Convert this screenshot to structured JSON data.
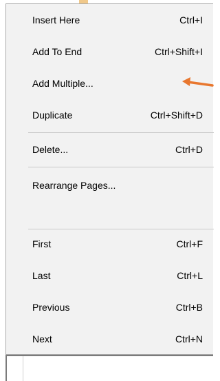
{
  "menu": {
    "items": [
      {
        "label": "Insert Here",
        "shortcut": "Ctrl+I"
      },
      {
        "label": "Add To End",
        "shortcut": "Ctrl+Shift+I"
      },
      {
        "label": "Add Multiple...",
        "shortcut": ""
      },
      {
        "label": "Duplicate",
        "shortcut": "Ctrl+Shift+D"
      },
      {
        "label": "Delete...",
        "shortcut": "Ctrl+D"
      },
      {
        "label": "Rearrange Pages...",
        "shortcut": ""
      },
      {
        "label": "First",
        "shortcut": "Ctrl+F"
      },
      {
        "label": "Last",
        "shortcut": "Ctrl+L"
      },
      {
        "label": "Previous",
        "shortcut": "Ctrl+B"
      },
      {
        "label": "Next",
        "shortcut": "Ctrl+N"
      }
    ]
  },
  "annotation": {
    "arrow_color": "#e8772e",
    "points_to": "Add Multiple..."
  },
  "colors": {
    "menu_background": "#f2f2f2",
    "separator": "#c9c9c9",
    "text": "#000000"
  }
}
